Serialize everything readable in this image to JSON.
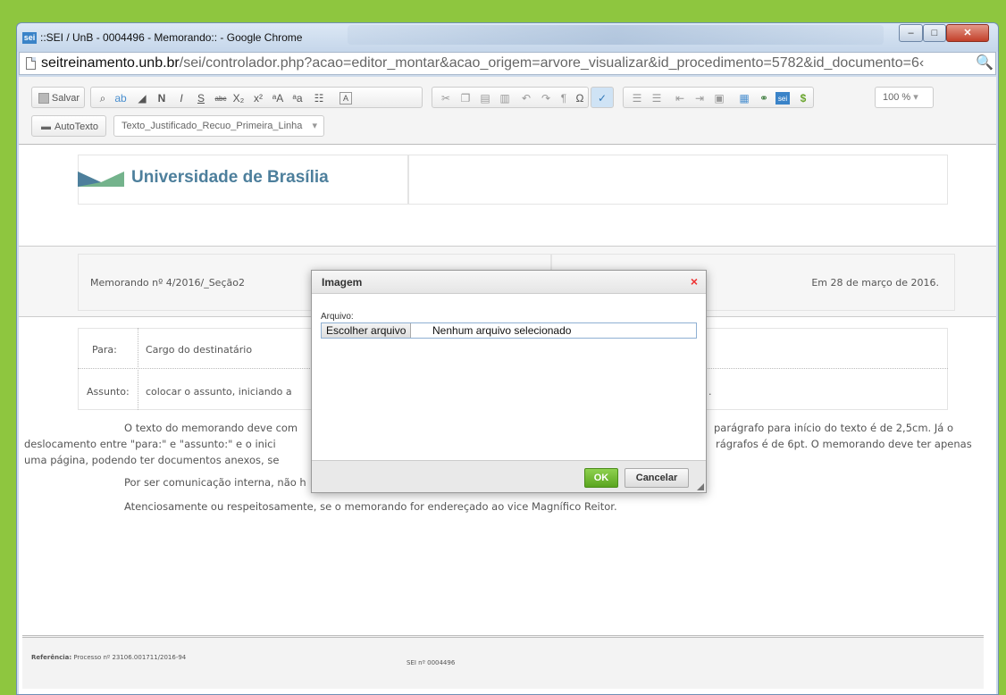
{
  "window": {
    "favicon": "sei",
    "title": "::SEI / UnB - 0004496 - Memorando:: - Google Chrome",
    "minimize": "–",
    "maximize": "□",
    "close": "✕",
    "url_host": "seitreinamento.unb.br",
    "url_path": "/sei/controlador.php?acao=editor_montar&acao_origem=arvore_visualizar&id_procedimento=5782&id_documento=6‹",
    "zoom_icon": "🔍"
  },
  "toolbar": {
    "save": "Salvar",
    "autotexto": "AutoTexto",
    "style": "Texto_Justificado_Recuo_Primeira_Linha",
    "zoom": "100 %",
    "bold": "N",
    "italic": "I",
    "underline": "S",
    "strike": "abc",
    "subscript": "X₂",
    "superscript": "x²",
    "omega": "Ω",
    "pilcrow": "¶",
    "dollar": "$",
    "sei_badge": "sei"
  },
  "document": {
    "university": "Universidade de Brasília",
    "memo_number": "Memorando nº 4/2016/_Seção2",
    "date": "Em  28 de março de 2016.",
    "para_label": "Para:",
    "para_value": "Cargo do destinatário",
    "assunto_label": "Assunto:",
    "assunto_value": "colocar o assunto, iniciando a",
    "assunto_tail": ".",
    "p1_line1": "O texto do memorando deve com",
    "p1_line1_right": "parágrafo para início do texto é de 2,5cm. Já o",
    "p1_line2": "deslocamento entre \"para:\" e \"assunto:\" e o inici",
    "p1_line2_right": "rágrafos é de 6pt. O memorando deve ter apenas",
    "p1_line3": "uma página, podendo ter documentos anexos, se",
    "p2": "Por ser comunicação interna, não h",
    "p3": "Atenciosamente ou respeitosamente, se o memorando for endereçado ao vice Magnífico Reitor.",
    "ref_label": "Referência:",
    "ref_value": "Processo nº 23106.001711/2016-94",
    "sei_number": "SEI nº 0004496"
  },
  "dialog": {
    "title": "Imagem",
    "close": "×",
    "file_label": "Arquivo:",
    "choose_button": "Escolher arquivo",
    "file_status": "Nenhum arquivo selecionado",
    "ok": "OK",
    "cancel": "Cancelar"
  },
  "colors": {
    "background": "#8ec63f",
    "ok_green": "#5aa51f",
    "brand_blue": "#4d7f9c"
  }
}
